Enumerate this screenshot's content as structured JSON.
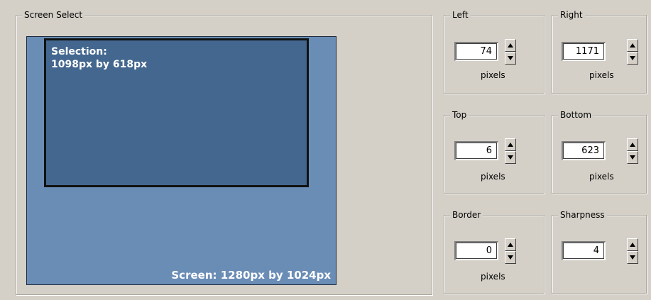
{
  "screen_select": {
    "title": "Screen Select",
    "selection_line1": "Selection:",
    "selection_line2": "1098px by 618px",
    "screen_label": "Screen: 1280px by 1024px"
  },
  "fields": {
    "left": {
      "title": "Left",
      "value": "74",
      "unit": "pixels"
    },
    "right": {
      "title": "Right",
      "value": "1171",
      "unit": "pixels"
    },
    "top": {
      "title": "Top",
      "value": "6",
      "unit": "pixels"
    },
    "bottom": {
      "title": "Bottom",
      "value": "623",
      "unit": "pixels"
    },
    "border": {
      "title": "Border",
      "value": "0",
      "unit": "pixels"
    },
    "sharpness": {
      "title": "Sharpness",
      "value": "4"
    }
  }
}
